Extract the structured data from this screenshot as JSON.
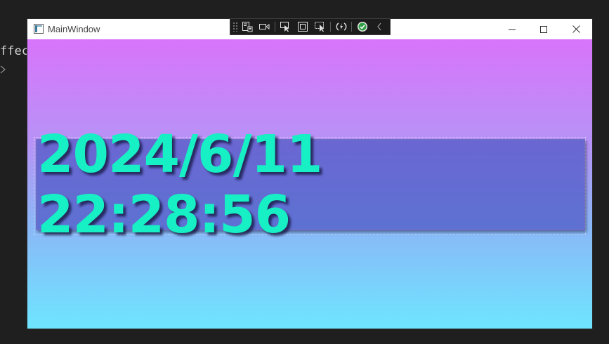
{
  "editor": {
    "partial_text": "ffec"
  },
  "window": {
    "title": "MainWindow"
  },
  "clock": {
    "datetime": "2024/6/11 22:28:56"
  },
  "colors": {
    "gradient_top": "#d874fb",
    "gradient_bottom": "#6ee5ff",
    "clock_text": "#17f0c4",
    "clock_box": "#4c56c4"
  },
  "debug_toolbar": {
    "icons": [
      "live-visual-tree-icon",
      "record-icon",
      "select-element-icon",
      "display-layout-adorners-icon",
      "track-focus-icon",
      "hot-reload-icon",
      "hot-reload-status-icon",
      "collapse-toolbar-icon"
    ]
  }
}
